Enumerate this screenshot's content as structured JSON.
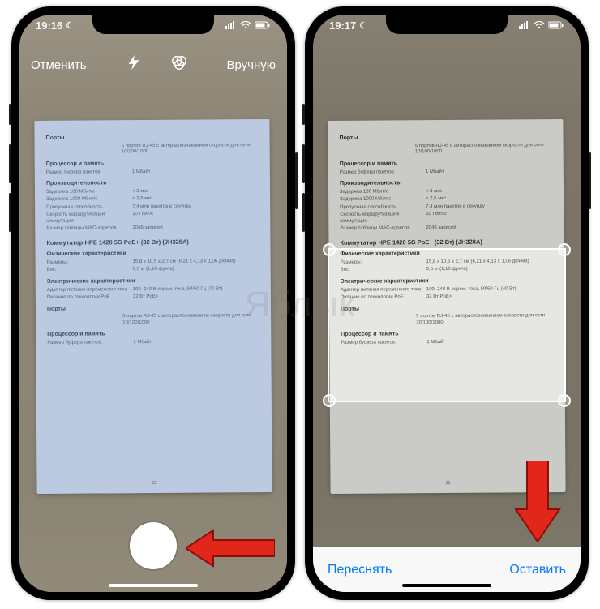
{
  "watermark": "Яблык",
  "phone1": {
    "status": {
      "time": "19:16",
      "dnd": "☾"
    },
    "toolbar": {
      "cancel": "Отменить",
      "manual": "Вручную"
    }
  },
  "phone2": {
    "status": {
      "time": "19:17",
      "dnd": "☾"
    },
    "bottom": {
      "retake": "Переснять",
      "keep": "Оставить"
    }
  },
  "doc": {
    "s1_title": "Порты",
    "s1_r1_v": "5 портов RJ-45 с автораспознаванием скорости для сети 10/100/1000",
    "s2_title": "Процессор и память",
    "s2_r1_k": "Размер буфера пакетов:",
    "s2_r1_v": "1 Мбайт",
    "s3_title": "Производительность",
    "s3_r1_k": "Задержка 100 Мбит/с",
    "s3_r1_v": "< 3 мкс",
    "s3_r2_k": "Задержка 1000 Мбит/с",
    "s3_r2_v": "< 2,6 мкс",
    "s3_r3_k": "Пропускная способность",
    "s3_r3_v": "7,4 млн пакетов в секунду",
    "s3_r4_k": "Скорость маршрутизации/коммутации",
    "s3_r4_v": "10 Гбит/с",
    "s3_r5_k": "Размер таблицы MAC-адресов",
    "s3_r5_v": "2048 записей",
    "product": "Коммутатор HPE 1420 5G PoE+ (32 Вт) (JH328A)",
    "s4_title": "Физические характеристики",
    "s4_r1_k": "Размеры:",
    "s4_r1_v": "15,8 x 10,5 x 2,7 см (6,21 x 4,13 x 1,06 дюйма)",
    "s4_r2_k": "Вес:",
    "s4_r2_v": "0,5 кг (1,10 фунта)",
    "s5_title": "Электрические характеристики",
    "s5_r1_k": "Адаптер питания переменного тока",
    "s5_r1_v": "100–240 В перем. тока, 50/60 Гц (40 Вт)",
    "s5_r2_k": "Питание по технологии PoE",
    "s5_r2_v": "32 Вт PoE+",
    "s6_title": "Порты",
    "s6_r1_v": "5 портов RJ-45 с автораспознаванием скорости для сети 10/100/1000",
    "s7_title": "Процессор и память",
    "s7_r1_k": "Размер буфера пакетов:",
    "s7_r1_v": "1 Мбайт",
    "page_no": "11"
  }
}
